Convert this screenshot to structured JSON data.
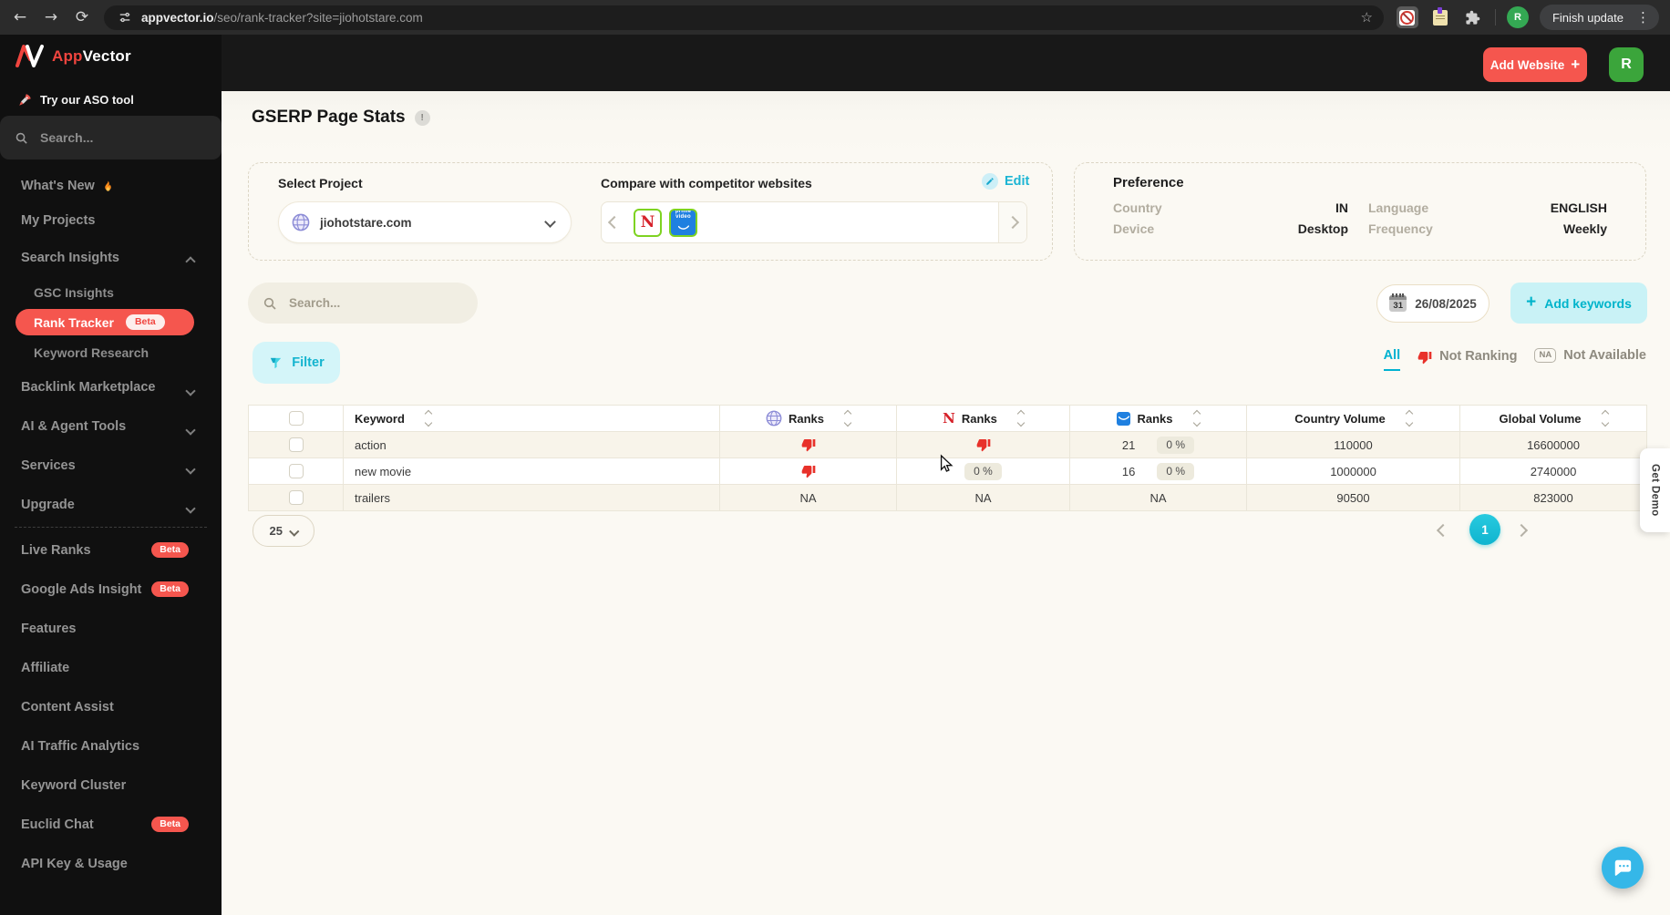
{
  "browser": {
    "url_host": "appvector.io",
    "url_path": "/seo/rank-tracker?site=jiohotstare.com",
    "finish_update": "Finish update",
    "menu_dots": "⋮",
    "back": "←",
    "forward": "→",
    "reload": "⟳",
    "star": "☆"
  },
  "sidebar": {
    "logo_app": "App",
    "logo_vector": "Vector",
    "aso_label": "Try our ASO tool",
    "search_placeholder": "Search...",
    "items": [
      {
        "label": "What's New",
        "flame": true,
        "compact": true
      },
      {
        "label": "My Projects",
        "compact": true
      },
      {
        "label": "Search Insights",
        "chevron": "up"
      },
      {
        "label": "GSC Insights",
        "sub": true
      },
      {
        "label": "Rank Tracker",
        "sub": true,
        "active": true,
        "badge": "Beta",
        "badge_style": "light"
      },
      {
        "label": "Keyword Research",
        "sub": true
      },
      {
        "label": "Backlink Marketplace",
        "chevron": "down"
      },
      {
        "label": "AI & Agent Tools",
        "chevron": "down"
      },
      {
        "label": "Services",
        "chevron": "down"
      },
      {
        "label": "Upgrade",
        "chevron": "down",
        "divider_after": true
      },
      {
        "label": "Live Ranks",
        "badge": "Beta"
      },
      {
        "label": "Google Ads Insight",
        "badge": "Beta"
      },
      {
        "label": "Features"
      },
      {
        "label": "Affiliate"
      },
      {
        "label": "Content Assist"
      },
      {
        "label": "AI Traffic Analytics"
      },
      {
        "label": "Keyword Cluster"
      },
      {
        "label": "Euclid Chat",
        "badge": "Beta"
      },
      {
        "label": "API Key & Usage"
      }
    ]
  },
  "header": {
    "add_website": "Add Website",
    "add_website_plus": "+",
    "avatar": "R",
    "title": "GSERP Page Stats",
    "info_mark": "!"
  },
  "project_panel": {
    "select_label": "Select Project",
    "project": "jiohotstare.com",
    "compare_label": "Compare with competitor websites",
    "edit_label": "Edit",
    "competitors": [
      {
        "name": "Netflix",
        "letter": "N"
      },
      {
        "name": "Prime Video",
        "line1": "prime",
        "line2": "video"
      }
    ]
  },
  "preference": {
    "title": "Preference",
    "items": [
      {
        "label": "Country",
        "value": "IN"
      },
      {
        "label": "Language",
        "value": "ENGLISH"
      },
      {
        "label": "Device",
        "value": "Desktop"
      },
      {
        "label": "Frequency",
        "value": "Weekly"
      }
    ]
  },
  "toolbar": {
    "search_placeholder": "Search...",
    "calendar_day": "31",
    "date": "26/08/2025",
    "add_keywords_plus": "+",
    "add_keywords": "Add keywords",
    "filter": "Filter"
  },
  "filter_tabs": [
    {
      "id": "all",
      "label": "All",
      "active": true
    },
    {
      "id": "not-ranking",
      "label": "Not Ranking",
      "icon": "thumb-down"
    },
    {
      "id": "not-available",
      "label": "Not Available",
      "icon": "na",
      "na_text": "NA"
    }
  ],
  "table": {
    "columns": [
      {
        "label": "Keyword",
        "icon": null
      },
      {
        "label": "Ranks",
        "icon": "globe"
      },
      {
        "label": "Ranks",
        "icon": "netflix"
      },
      {
        "label": "Ranks",
        "icon": "prime"
      },
      {
        "label": "Country Volume",
        "icon": null
      },
      {
        "label": "Global Volume",
        "icon": null
      }
    ],
    "rows": [
      {
        "keyword": "action",
        "cells": [
          {
            "type": "thumb"
          },
          {
            "type": "thumb"
          },
          {
            "type": "num-badge",
            "num": "21",
            "badge": "0 %"
          },
          {
            "type": "text",
            "text": "110000"
          },
          {
            "type": "text",
            "text": "16600000"
          }
        ]
      },
      {
        "keyword": "new movie",
        "cells": [
          {
            "type": "thumb"
          },
          {
            "type": "badge",
            "badge": "0 %"
          },
          {
            "type": "num-badge",
            "num": "16",
            "badge": "0 %"
          },
          {
            "type": "text",
            "text": "1000000"
          },
          {
            "type": "text",
            "text": "2740000"
          }
        ]
      },
      {
        "keyword": "trailers",
        "cells": [
          {
            "type": "na",
            "text": "NA"
          },
          {
            "type": "na",
            "text": "NA"
          },
          {
            "type": "na",
            "text": "NA"
          },
          {
            "type": "text",
            "text": "90500"
          },
          {
            "type": "text",
            "text": "823000"
          }
        ]
      }
    ]
  },
  "pagination": {
    "page_size": "25",
    "current_page": "1"
  },
  "side_rail": {
    "get_demo": "Get Demo"
  },
  "colors": {
    "accent_cyan": "#00b4cb",
    "brand_red": "#f5564e",
    "thumb_red": "#e8312a",
    "competitor_border_green": "#7ed321",
    "prime_blue": "#1f80e0",
    "avatar_green": "#3ba53b"
  }
}
